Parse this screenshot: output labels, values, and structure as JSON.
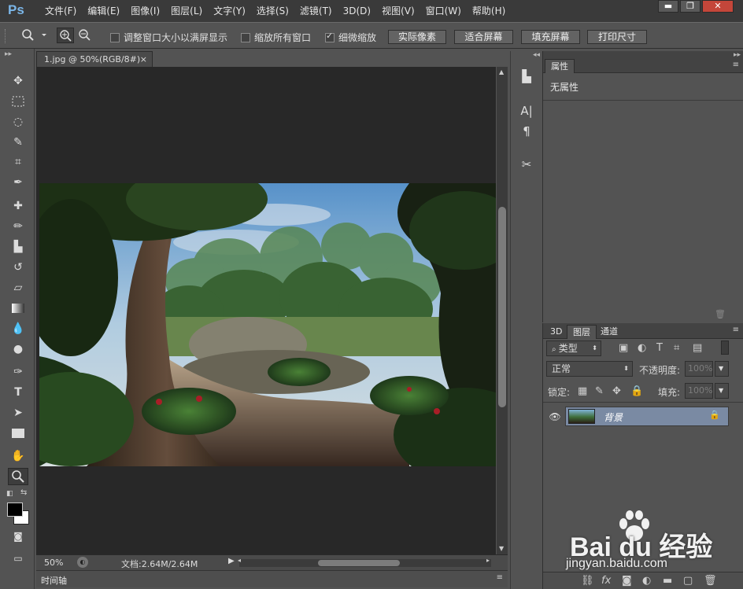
{
  "app": {
    "logo": "Ps"
  },
  "menu": [
    "文件(F)",
    "编辑(E)",
    "图像(I)",
    "图层(L)",
    "文字(Y)",
    "选择(S)",
    "滤镜(T)",
    "3D(D)",
    "视图(V)",
    "窗口(W)",
    "帮助(H)"
  ],
  "window_buttons": {
    "minimize": "▬",
    "restore": "❐",
    "close": "✕"
  },
  "options": {
    "check_resize": {
      "label": "调整窗口大小以满屏显示",
      "checked": false
    },
    "check_zoom_all": {
      "label": "缩放所有窗口",
      "checked": false
    },
    "check_scrubby": {
      "label": "细微缩放",
      "checked": true
    },
    "btn_actual": "实际像素",
    "btn_fit": "适合屏幕",
    "btn_fill": "填充屏幕",
    "btn_print": "打印尺寸"
  },
  "document": {
    "tab_title": "1.jpg @ 50%(RGB/8#)",
    "tab_close": "×"
  },
  "status": {
    "zoom": "50%",
    "doc_info": "文档:2.64M/2.64M"
  },
  "timeline": {
    "label": "时间轴"
  },
  "properties": {
    "tab": "属性",
    "content": "无属性"
  },
  "layers_panel": {
    "tabs": [
      "3D",
      "图层",
      "通道"
    ],
    "filter": "类型",
    "blend_mode": "正常",
    "opacity_label": "不透明度:",
    "opacity_value": "100%",
    "lock_label": "锁定:",
    "fill_label": "填充:",
    "fill_value": "100%",
    "layer_name": "背景"
  },
  "watermark": {
    "text": "Bai du 经验",
    "url": "jingyan.baidu.com"
  },
  "colors": {
    "accent": "#7bb6e8",
    "layer_selected": "#7a8aa3"
  }
}
